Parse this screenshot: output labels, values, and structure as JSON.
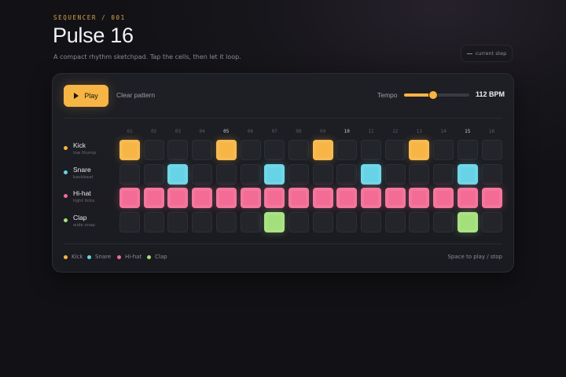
{
  "header": {
    "eyebrow": "SEQUENCER / 001",
    "title": "Pulse 16",
    "subtitle": "A compact rhythm sketchpad. Tap the cells, then let it loop.",
    "step_indicator": "current step"
  },
  "toolbar": {
    "play_label": "Play",
    "clear_label": "Clear pattern",
    "tempo_label": "Tempo",
    "bpm_text": "112 BPM",
    "tempo_fraction": 0.44
  },
  "steps": [
    "01",
    "02",
    "03",
    "04",
    "05",
    "06",
    "07",
    "08",
    "09",
    "10",
    "11",
    "12",
    "13",
    "14",
    "15",
    "16"
  ],
  "accent_steps": [
    4,
    9,
    14
  ],
  "tracks": [
    {
      "name": "Kick",
      "subtitle": "low thump",
      "color": "#f7b545",
      "pattern": [
        1,
        0,
        0,
        0,
        1,
        0,
        0,
        0,
        1,
        0,
        0,
        0,
        1,
        0,
        0,
        0
      ]
    },
    {
      "name": "Snare",
      "subtitle": "backbeat",
      "color": "#66d4e6",
      "pattern": [
        0,
        0,
        1,
        0,
        0,
        0,
        1,
        0,
        0,
        0,
        1,
        0,
        0,
        0,
        1,
        0
      ]
    },
    {
      "name": "Hi-hat",
      "subtitle": "tight ticks",
      "color": "#f26c95",
      "pattern": [
        1,
        1,
        1,
        1,
        1,
        1,
        1,
        1,
        1,
        1,
        1,
        1,
        1,
        1,
        1,
        1
      ]
    },
    {
      "name": "Clap",
      "subtitle": "wide snap",
      "color": "#a3e07c",
      "pattern": [
        0,
        0,
        0,
        0,
        0,
        0,
        1,
        0,
        0,
        0,
        0,
        0,
        0,
        0,
        1,
        0
      ]
    }
  ],
  "legend": [
    {
      "label": "Kick",
      "color": "#f7b545"
    },
    {
      "label": "Snare",
      "color": "#66d4e6"
    },
    {
      "label": "Hi-hat",
      "color": "#f26c95"
    },
    {
      "label": "Clap",
      "color": "#a3e07c"
    }
  ],
  "hint": "Space to play / stop"
}
